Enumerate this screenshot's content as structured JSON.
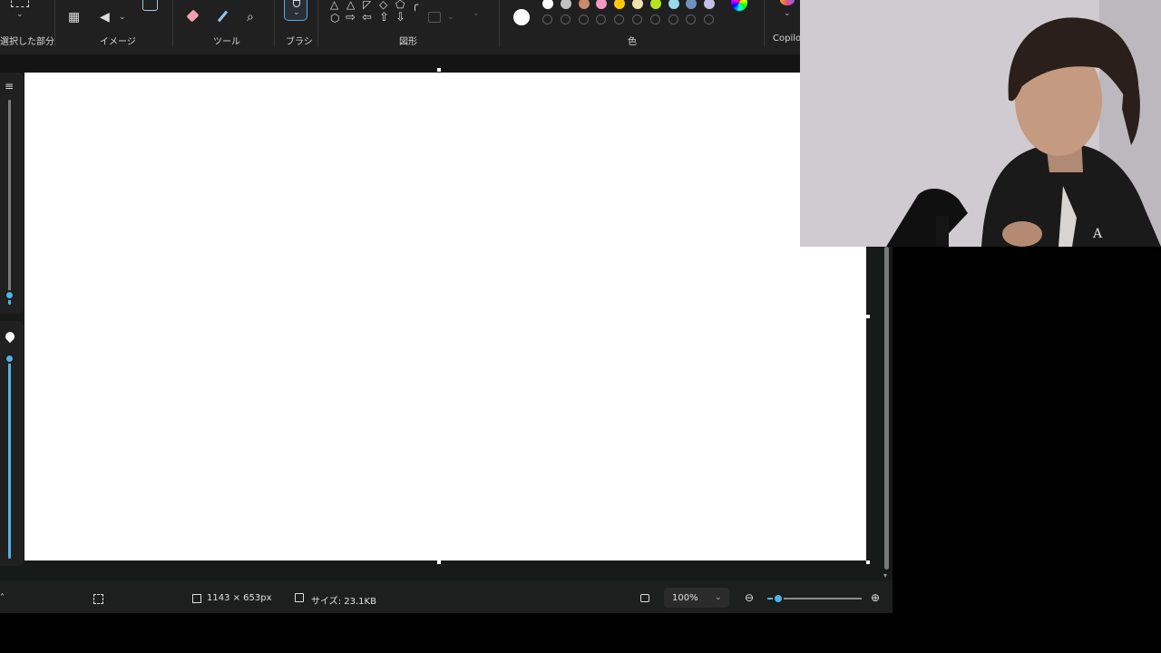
{
  "ribbon": {
    "groups": {
      "selection": "選択した部分",
      "image": "イメージ",
      "tools": "ツール",
      "brush": "ブラシ",
      "shapes": "図形",
      "colors": "色",
      "copilot": "Copilot"
    },
    "shape_glyphs": [
      "△",
      "△",
      "◸",
      "◇",
      "⬠",
      "╭",
      "⬡",
      "⇨",
      "⇦",
      "⇧",
      "⇩"
    ],
    "palette_filled": [
      "#ffffff",
      "#c3c3c3",
      "#c98b6b",
      "#f39ac0",
      "#ffc90e",
      "#efe4b0",
      "#b5e61d",
      "#99d9ea",
      "#7092be",
      "#c8bfe7"
    ],
    "palette_empty_count": 10,
    "active_color": "#ffffff"
  },
  "side_panel": {
    "top_icon": "brush-size-icon",
    "bottom_icon": "opacity-drop-icon",
    "accent": "#4fb3e8"
  },
  "status": {
    "canvas_size": "1143 × 653px",
    "file_size": "サイズ: 23.1KB",
    "zoom": "100%"
  },
  "icons": {
    "select": "select-rectangle-icon",
    "image_crop": "image-crop-icon",
    "eraser": "eraser-icon",
    "color_picker": "color-picker-icon",
    "magnifier": "magnifier-icon",
    "fit": "fit-to-window-icon",
    "zoom_out": "zoom-out-icon",
    "zoom_in": "zoom-in-icon",
    "save": "save-icon"
  }
}
